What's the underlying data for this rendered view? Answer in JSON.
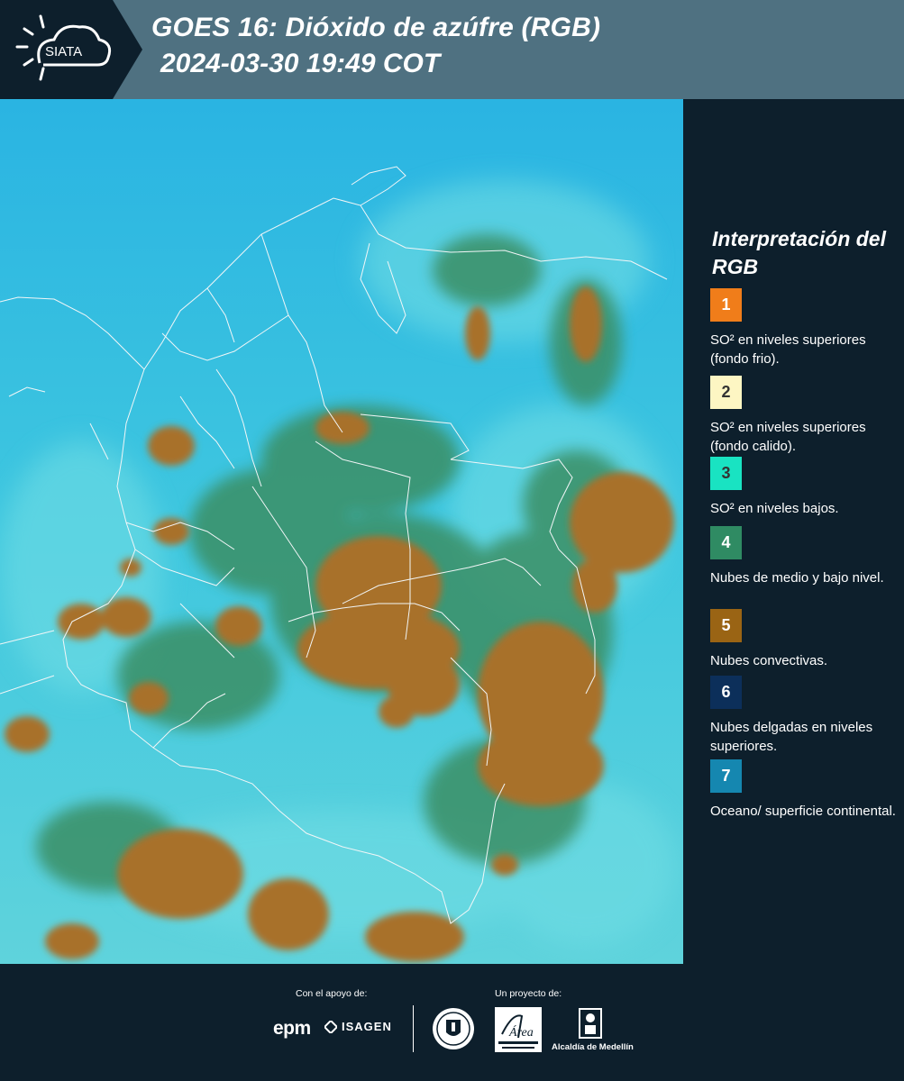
{
  "header": {
    "logo_text": "SIATA",
    "title_line1": "GOES 16: Dióxido de azúfre (RGB)",
    "title_line2": "2024-03-30 19:49 COT"
  },
  "map": {
    "description_icon": "satellite-rgb-map",
    "ocean_color": "#2bb8e0",
    "convective_color": "#a8712b",
    "low_cloud_color": "#3c8f63"
  },
  "legend": {
    "title": "Interpretación del RGB",
    "items": [
      {
        "number": "1",
        "color": "#f07d1a",
        "label": "SO² en niveles superiores (fondo frio)."
      },
      {
        "number": "2",
        "color": "#fdf6c3",
        "label": "SO² en niveles superiores (fondo calido)."
      },
      {
        "number": "3",
        "color": "#19e3c2",
        "label": "SO² en niveles bajos."
      },
      {
        "number": "4",
        "color": "#2f8b63",
        "label": "Nubes de medio y bajo nivel."
      },
      {
        "number": "5",
        "color": "#9a6414",
        "label": "Nubes convectivas."
      },
      {
        "number": "6",
        "color": "#0c2f5a",
        "label": "Nubes delgadas en niveles superiores."
      },
      {
        "number": "7",
        "color": "#1587b0",
        "label": "Oceano/ superficie continental."
      }
    ]
  },
  "footer": {
    "support_label": "Con el apoyo de:",
    "project_label": "Un proyecto de:",
    "epm": "epm",
    "isagen": "ISAGEN",
    "area_logo_text": "Área",
    "alcaldia": "Alcaldía de Medellín"
  }
}
